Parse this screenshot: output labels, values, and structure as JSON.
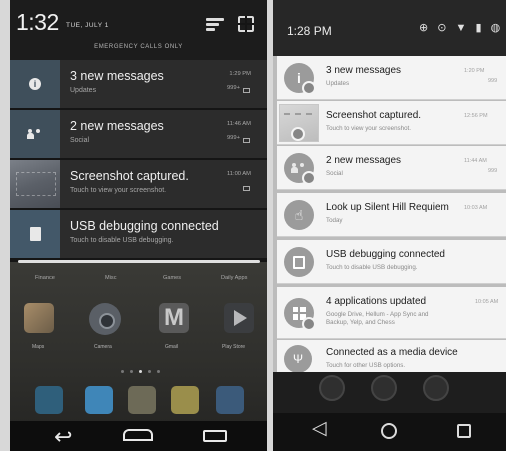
{
  "left": {
    "time": "1:32",
    "date": "TUE, JULY 1",
    "emergency": "EMERGENCY CALLS ONLY",
    "notifications": [
      {
        "title": "3 new messages",
        "subtitle": "Updates",
        "time": "1:29 PM",
        "count": "999+",
        "icon": "info-icon"
      },
      {
        "title": "2 new messages",
        "subtitle": "Social",
        "time": "11:46 AM",
        "count": "999+",
        "icon": "people-icon"
      },
      {
        "title": "Screenshot captured.",
        "subtitle": "Touch to view your screenshot.",
        "time": "11:00 AM",
        "icon": "screenshot-thumbnail"
      },
      {
        "title": "USB debugging connected",
        "subtitle": "Touch to disable USB debugging.",
        "icon": "usb-icon"
      }
    ],
    "folders": [
      "Finance",
      "Misc",
      "Games",
      "Daily Apps"
    ],
    "apps": [
      "Maps",
      "Camera",
      "Gmail",
      "Play Store"
    ],
    "dock_colors": [
      "#2f5f7b",
      "#3f86b8",
      "#6d6a57",
      "#9a8e4b",
      "#3b5a7a"
    ]
  },
  "right": {
    "time": "1:28 PM",
    "status_icons": "⊕ ⊙ ▼ ▮ ◍",
    "notifications": [
      {
        "title": "3 new messages",
        "subtitle": "Updates",
        "time": "1:20 PM",
        "count": "999",
        "icon": "info-icon"
      },
      {
        "title": "Screenshot captured.",
        "subtitle": "Touch to view your screenshot.",
        "time": "12:56 PM",
        "icon": "screenshot-thumbnail"
      },
      {
        "title": "2 new messages",
        "subtitle": "Social",
        "time": "11:44 AM",
        "count": "999",
        "icon": "people-icon"
      },
      {
        "title": "Look up Silent Hill Requiem",
        "subtitle": "Today",
        "time": "10:03 AM",
        "icon": "reminder-icon"
      },
      {
        "title": "USB debugging connected",
        "subtitle": "Touch to disable USB debugging.",
        "icon": "usb-icon"
      },
      {
        "title": "4 applications updated",
        "subtitle": "Google Drive, Hellum - App Sync and",
        "subtitle2": "Backup, Yelp, and Chess",
        "time": "10:05 AM",
        "icon": "apps-updated-icon"
      },
      {
        "title": "Connected as a media device",
        "subtitle": "Touch for other USB options.",
        "icon": "usb-media-icon"
      }
    ]
  }
}
